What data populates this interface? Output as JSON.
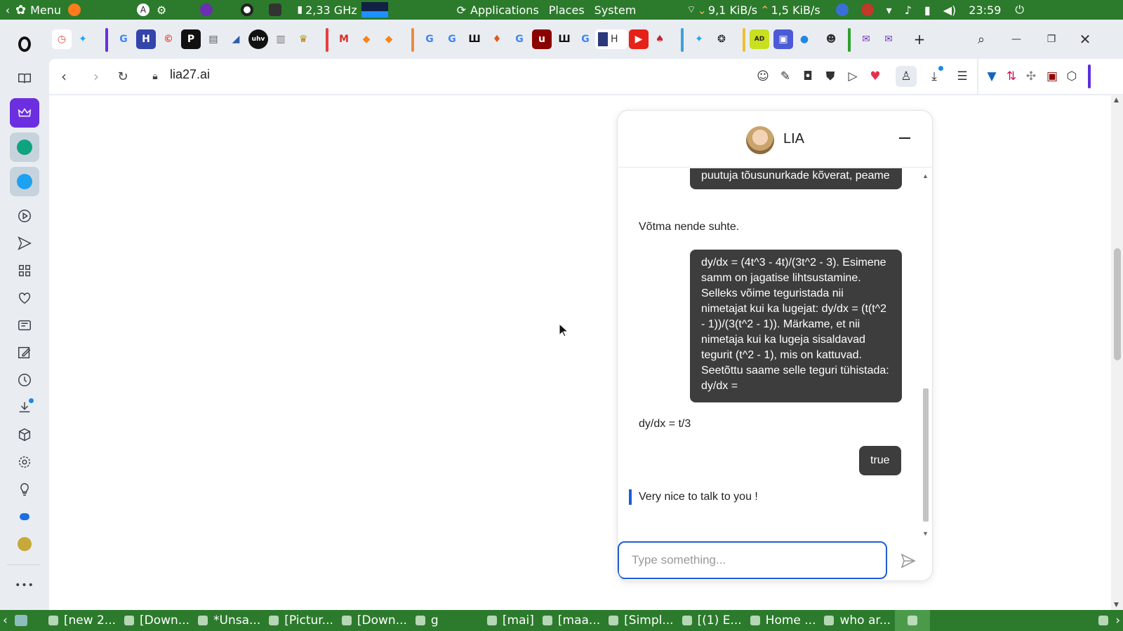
{
  "system_panel": {
    "menu_label": "Menu",
    "cpu": "2,33 GHz",
    "applications": "Applications",
    "places": "Places",
    "system": "System",
    "net_down": "9,1 KiB/s",
    "net_up": "1,5 KiB/s",
    "clock": "23:59"
  },
  "browser": {
    "url": "lia27.ai",
    "sidebar_more": "•••"
  },
  "chat": {
    "bot_name": "LIA",
    "messages": [
      {
        "role": "user",
        "text": "puutuja tõusunurkade kõverat, peame"
      },
      {
        "role": "bot",
        "text": "Võtma nende suhte."
      },
      {
        "role": "user",
        "text": "dy/dx = (4t^3 - 4t)/(3t^2 - 3). Esimene samm on jagatise lihtsustamine. Selleks võime teguristada nii nimetajat kui ka lugejat: dy/dx = (t(t^2 - 1))/(3(t^2 - 1)). Märkame, et nii nimetaja kui ka lugeja sisaldavad tegurit (t^2 - 1), mis on kattuvad. Seetõttu saame selle teguri tühistada: dy/dx ="
      },
      {
        "role": "bot",
        "text": "dy/dx = t/3"
      },
      {
        "role": "user",
        "text": "true"
      },
      {
        "role": "bot",
        "text": "Very nice to talk to you !"
      }
    ],
    "input_placeholder": "Type something..."
  },
  "taskbar": {
    "tasks": [
      "[new 2...",
      "[Down...",
      "*Unsa...",
      "[Pictur...",
      "[Down...",
      "g",
      "[mai]",
      "[maa...",
      "[Simpl...",
      "[(1) E...",
      "Home ...",
      "who ar..."
    ]
  },
  "colors": {
    "panel_green": "#2c7a2c",
    "user_bubble": "#3d3d3d",
    "accent_blue": "#1f5cd6"
  }
}
